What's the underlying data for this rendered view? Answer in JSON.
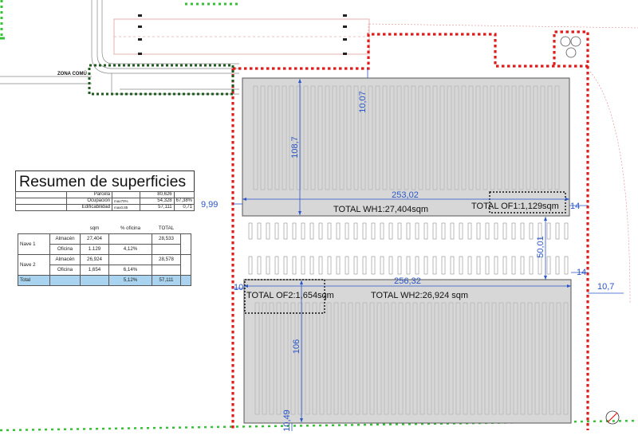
{
  "plan": {
    "zona_label": "ZONA COMÚ",
    "dimensions": {
      "wh1_height": "108,7",
      "wh1_top_gap": "10,07",
      "wh1_width": "253,02",
      "left_gap": "9,99",
      "right_gap_top": "14",
      "yard_depth": "50,01",
      "right_gap_mid": "14",
      "wh2_width": "256,32",
      "left_gap_2": "10",
      "right_offset": "10,7",
      "wh2_height": "106",
      "bottom_gap": "10,49"
    },
    "labels": {
      "total_wh1": "TOTAL WH1:27,404sqm",
      "total_of1": "TOTAL OF1:1,129sqm",
      "total_of2": "TOTAL OF2:1,654sqm",
      "total_wh2": "TOTAL WH2:26,924 sqm"
    },
    "colors": {
      "warehouse_fill": "#d7d7d7",
      "dimension": "#2a55c8",
      "site_boundary": "#e01b1b",
      "zone_boundary": "#1f5a1f",
      "green_edge": "#35c035",
      "total_row": "#a9d3ee"
    }
  },
  "summary": {
    "title": "Resumen de superficies",
    "rows": [
      {
        "label": "Parcela",
        "note": "",
        "value": "80,626",
        "extra": ""
      },
      {
        "label": "Ocupación",
        "note": "max70%",
        "value": "54,328",
        "extra": "67,38%"
      },
      {
        "label": "Edificabilidad",
        "note": "max0,85",
        "value": "57,111",
        "extra": "0,71"
      }
    ],
    "headers": [
      "sqm",
      "% oficina",
      "TOTAL"
    ],
    "naves": [
      {
        "name": "Nave 1",
        "almacen_label": "Almacén",
        "almacen": "27,404",
        "oficina_label": "Oficina",
        "oficina": "1.129",
        "pct": "4,12%",
        "total": "28,533"
      },
      {
        "name": "Nave 2",
        "almacen_label": "Almacén",
        "almacen": "26,924",
        "oficina_label": "Oficina",
        "oficina": "1,654",
        "pct": "6,14%",
        "total": "28,578"
      }
    ],
    "total": {
      "label": "Total",
      "pct": "5,12%",
      "total": "57,111"
    }
  }
}
